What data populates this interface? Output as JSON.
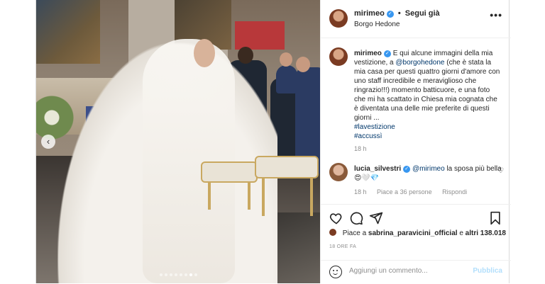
{
  "header": {
    "username": "mirimeo",
    "separator": "•",
    "follow_label": "Segui già",
    "location": "Borgo Hedone",
    "more_label": "•••"
  },
  "caption": {
    "username": "mirimeo",
    "text_1": "E qui alcune immagini della mia vestizione, a",
    "mention": "@borgohedone",
    "text_2": "(che è stata la mia casa per questi quattro giorni d'amore con uno staff incredibile e meraviglioso che ringrazio!!!) momento batticuore, e una foto che mi ha scattato in Chiesa mia cognata che è diventata una delle mie preferite di questi giorni ...",
    "hashtags": [
      "#lavestizione",
      "#accussì"
    ],
    "time": "18 h"
  },
  "comment": {
    "username": "lucia_silvestri",
    "mention": "@mirimeo",
    "text": "la sposa più bella😍🤍💎",
    "time": "18 h",
    "likes": "Piace a 36 persone",
    "reply_label": "Rispondi"
  },
  "actions": {
    "likes_prefix": "Piace a",
    "likes_user": "sabrina_paravicini_official",
    "likes_suffix": "e",
    "likes_others": "altri 138.018",
    "date": "18 ORE FA"
  },
  "add_comment": {
    "placeholder": "Aggiungi un commento...",
    "publish_label": "Pubblica"
  },
  "carousel": {
    "prev_label": "‹",
    "dot_count": 8,
    "active_index": 6
  },
  "colors": {
    "link": "#00376b",
    "verified": "#3897f0",
    "publish_disabled": "#b2dffc",
    "meta": "#8e8e8e"
  }
}
